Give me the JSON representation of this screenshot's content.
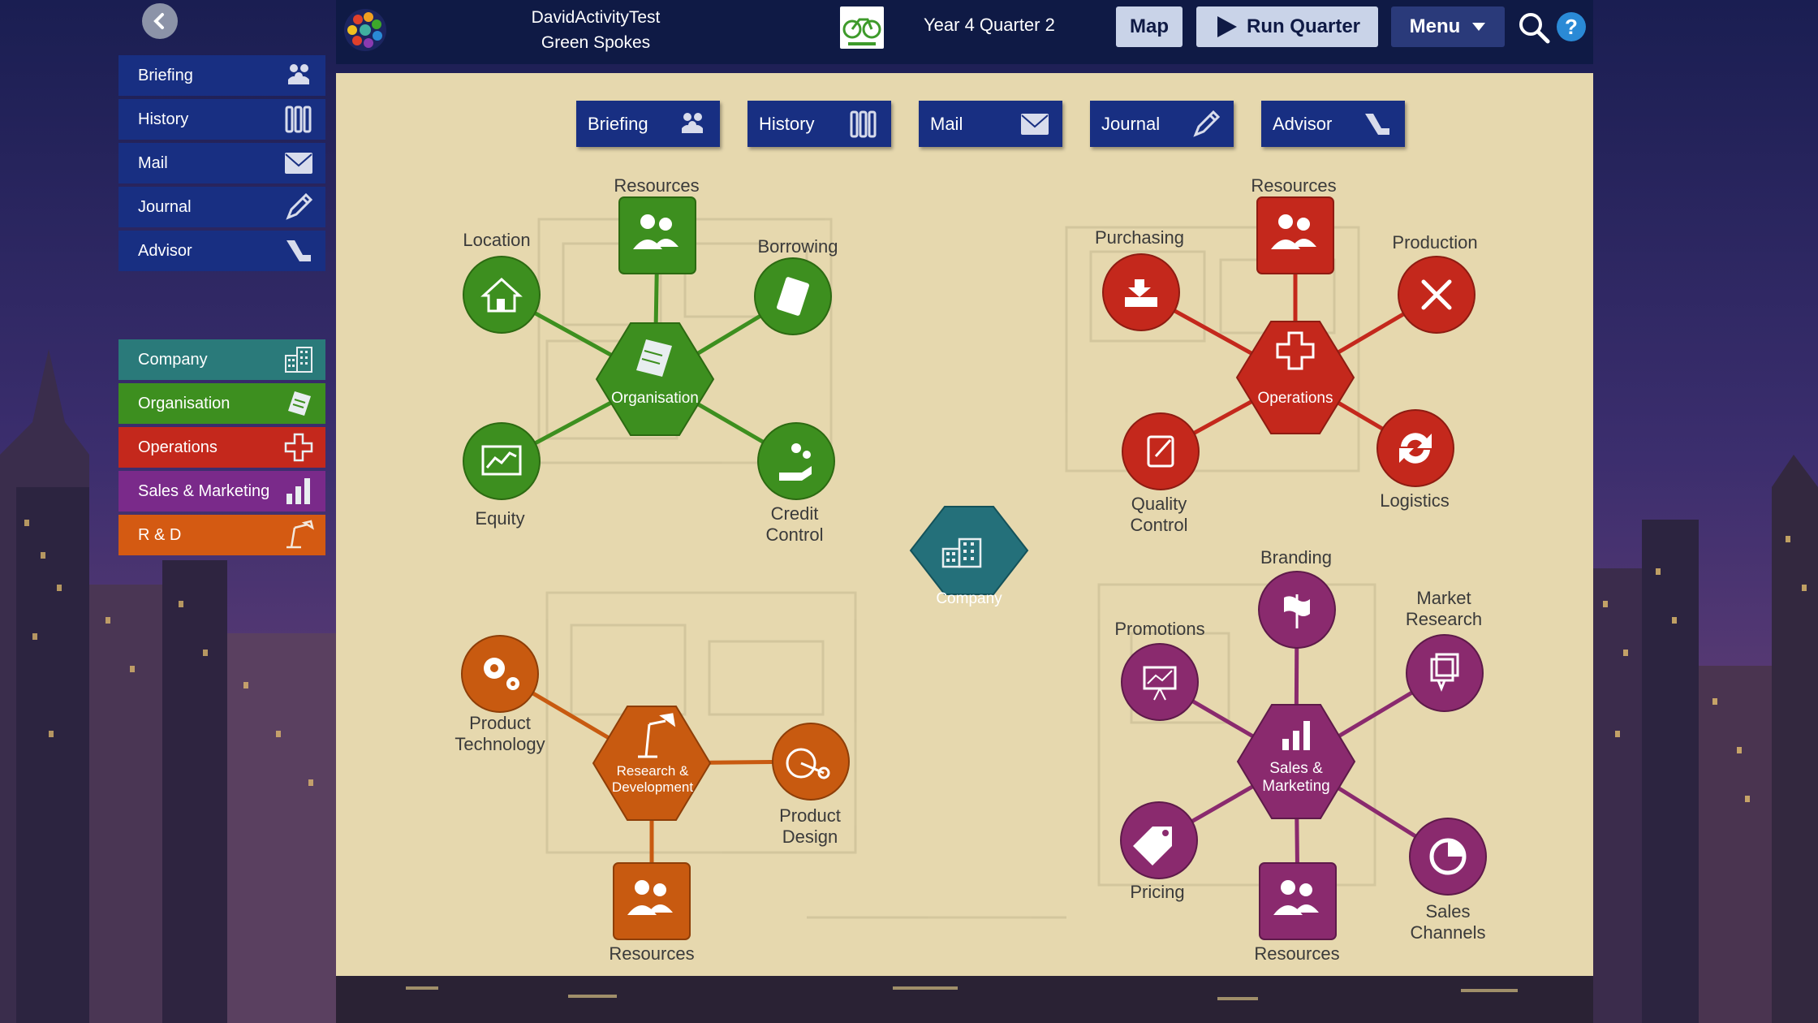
{
  "header": {
    "sim_name": "DavidActivityTest",
    "company_name": "Green Spokes",
    "period": "Year 4 Quarter 2",
    "map_button": "Map",
    "run_button": "Run Quarter",
    "menu_button": "Menu",
    "help_label": "?"
  },
  "sidebar": {
    "top": [
      {
        "label": "Briefing",
        "icon": "people-icon"
      },
      {
        "label": "History",
        "icon": "history-icon"
      },
      {
        "label": "Mail",
        "icon": "mail-icon"
      },
      {
        "label": "Journal",
        "icon": "pencil-icon"
      },
      {
        "label": "Advisor",
        "icon": "advisor-icon"
      }
    ],
    "bottom": [
      {
        "label": "Company",
        "color": "#2a7a7a",
        "icon": "building-icon"
      },
      {
        "label": "Organisation",
        "color": "#3d8f1f",
        "icon": "document-icon"
      },
      {
        "label": "Operations",
        "color": "#c4281c",
        "icon": "operations-icon"
      },
      {
        "label": "Sales & Marketing",
        "color": "#7a2a8a",
        "icon": "bar-chart-icon"
      },
      {
        "label": "R & D",
        "color": "#d45a12",
        "icon": "lamp-icon"
      }
    ]
  },
  "tabs": [
    {
      "label": "Briefing",
      "icon": "people-icon"
    },
    {
      "label": "History",
      "icon": "history-icon"
    },
    {
      "label": "Mail",
      "icon": "mail-icon"
    },
    {
      "label": "Journal",
      "icon": "pencil-icon"
    },
    {
      "label": "Advisor",
      "icon": "advisor-icon"
    }
  ],
  "colors": {
    "organisation": "#3d8f1f",
    "operations": "#c4281c",
    "company": "#24707a",
    "rnd": "#c85a10",
    "sales": "#8a2a6e",
    "panel": "#e6d8ae",
    "nav": "#182f82"
  },
  "clusters": {
    "organisation": {
      "hub": "Organisation",
      "nodes": [
        "Resources",
        "Location",
        "Borrowing",
        "Equity",
        "Credit Control"
      ]
    },
    "operations": {
      "hub": "Operations",
      "nodes": [
        "Resources",
        "Purchasing",
        "Production",
        "Quality Control",
        "Logistics"
      ]
    },
    "company": {
      "hub": "Company"
    },
    "rnd": {
      "hub_line1": "Research &",
      "hub_line2": "Development",
      "nodes": [
        "Product Technology",
        "Product Design",
        "Resources"
      ]
    },
    "sales": {
      "hub_line1": "Sales &",
      "hub_line2": "Marketing",
      "nodes": [
        "Branding",
        "Promotions",
        "Market Research",
        "Pricing",
        "Resources",
        "Sales Channels"
      ]
    }
  },
  "labels": {
    "org_resources": "Resources",
    "org_location": "Location",
    "org_borrowing": "Borrowing",
    "org_equity": "Equity",
    "org_credit_1": "Credit",
    "org_credit_2": "Control",
    "ops_resources": "Resources",
    "ops_purchasing": "Purchasing",
    "ops_production": "Production",
    "ops_quality_1": "Quality",
    "ops_quality_2": "Control",
    "ops_logistics": "Logistics",
    "rnd_tech_1": "Product",
    "rnd_tech_2": "Technology",
    "rnd_design_1": "Product",
    "rnd_design_2": "Design",
    "rnd_resources": "Resources",
    "sm_branding": "Branding",
    "sm_promotions": "Promotions",
    "sm_market_1": "Market",
    "sm_market_2": "Research",
    "sm_pricing": "Pricing",
    "sm_resources": "Resources",
    "sm_channels_1": "Sales",
    "sm_channels_2": "Channels"
  }
}
